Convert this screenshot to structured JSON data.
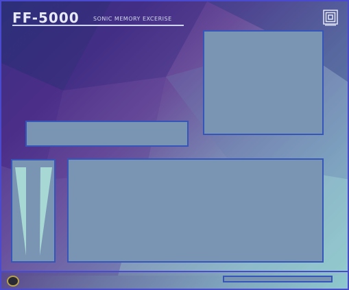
{
  "header": {
    "logo": "FF-5000",
    "subtitle": "SONIC MEMORY EXCERISE"
  },
  "icons": {
    "corner": "square-target-icon",
    "status": "knob-icon"
  },
  "colors": {
    "panel_fill": "#7a95b3",
    "panel_border": "#3655b8",
    "frame_border": "#4a4ad0",
    "meter_fill": "#a8d8d4",
    "knob_ring": "#b8a24a"
  },
  "meter": {
    "left_level": 1.0,
    "right_level": 1.0
  },
  "progress": {
    "value": 0
  }
}
